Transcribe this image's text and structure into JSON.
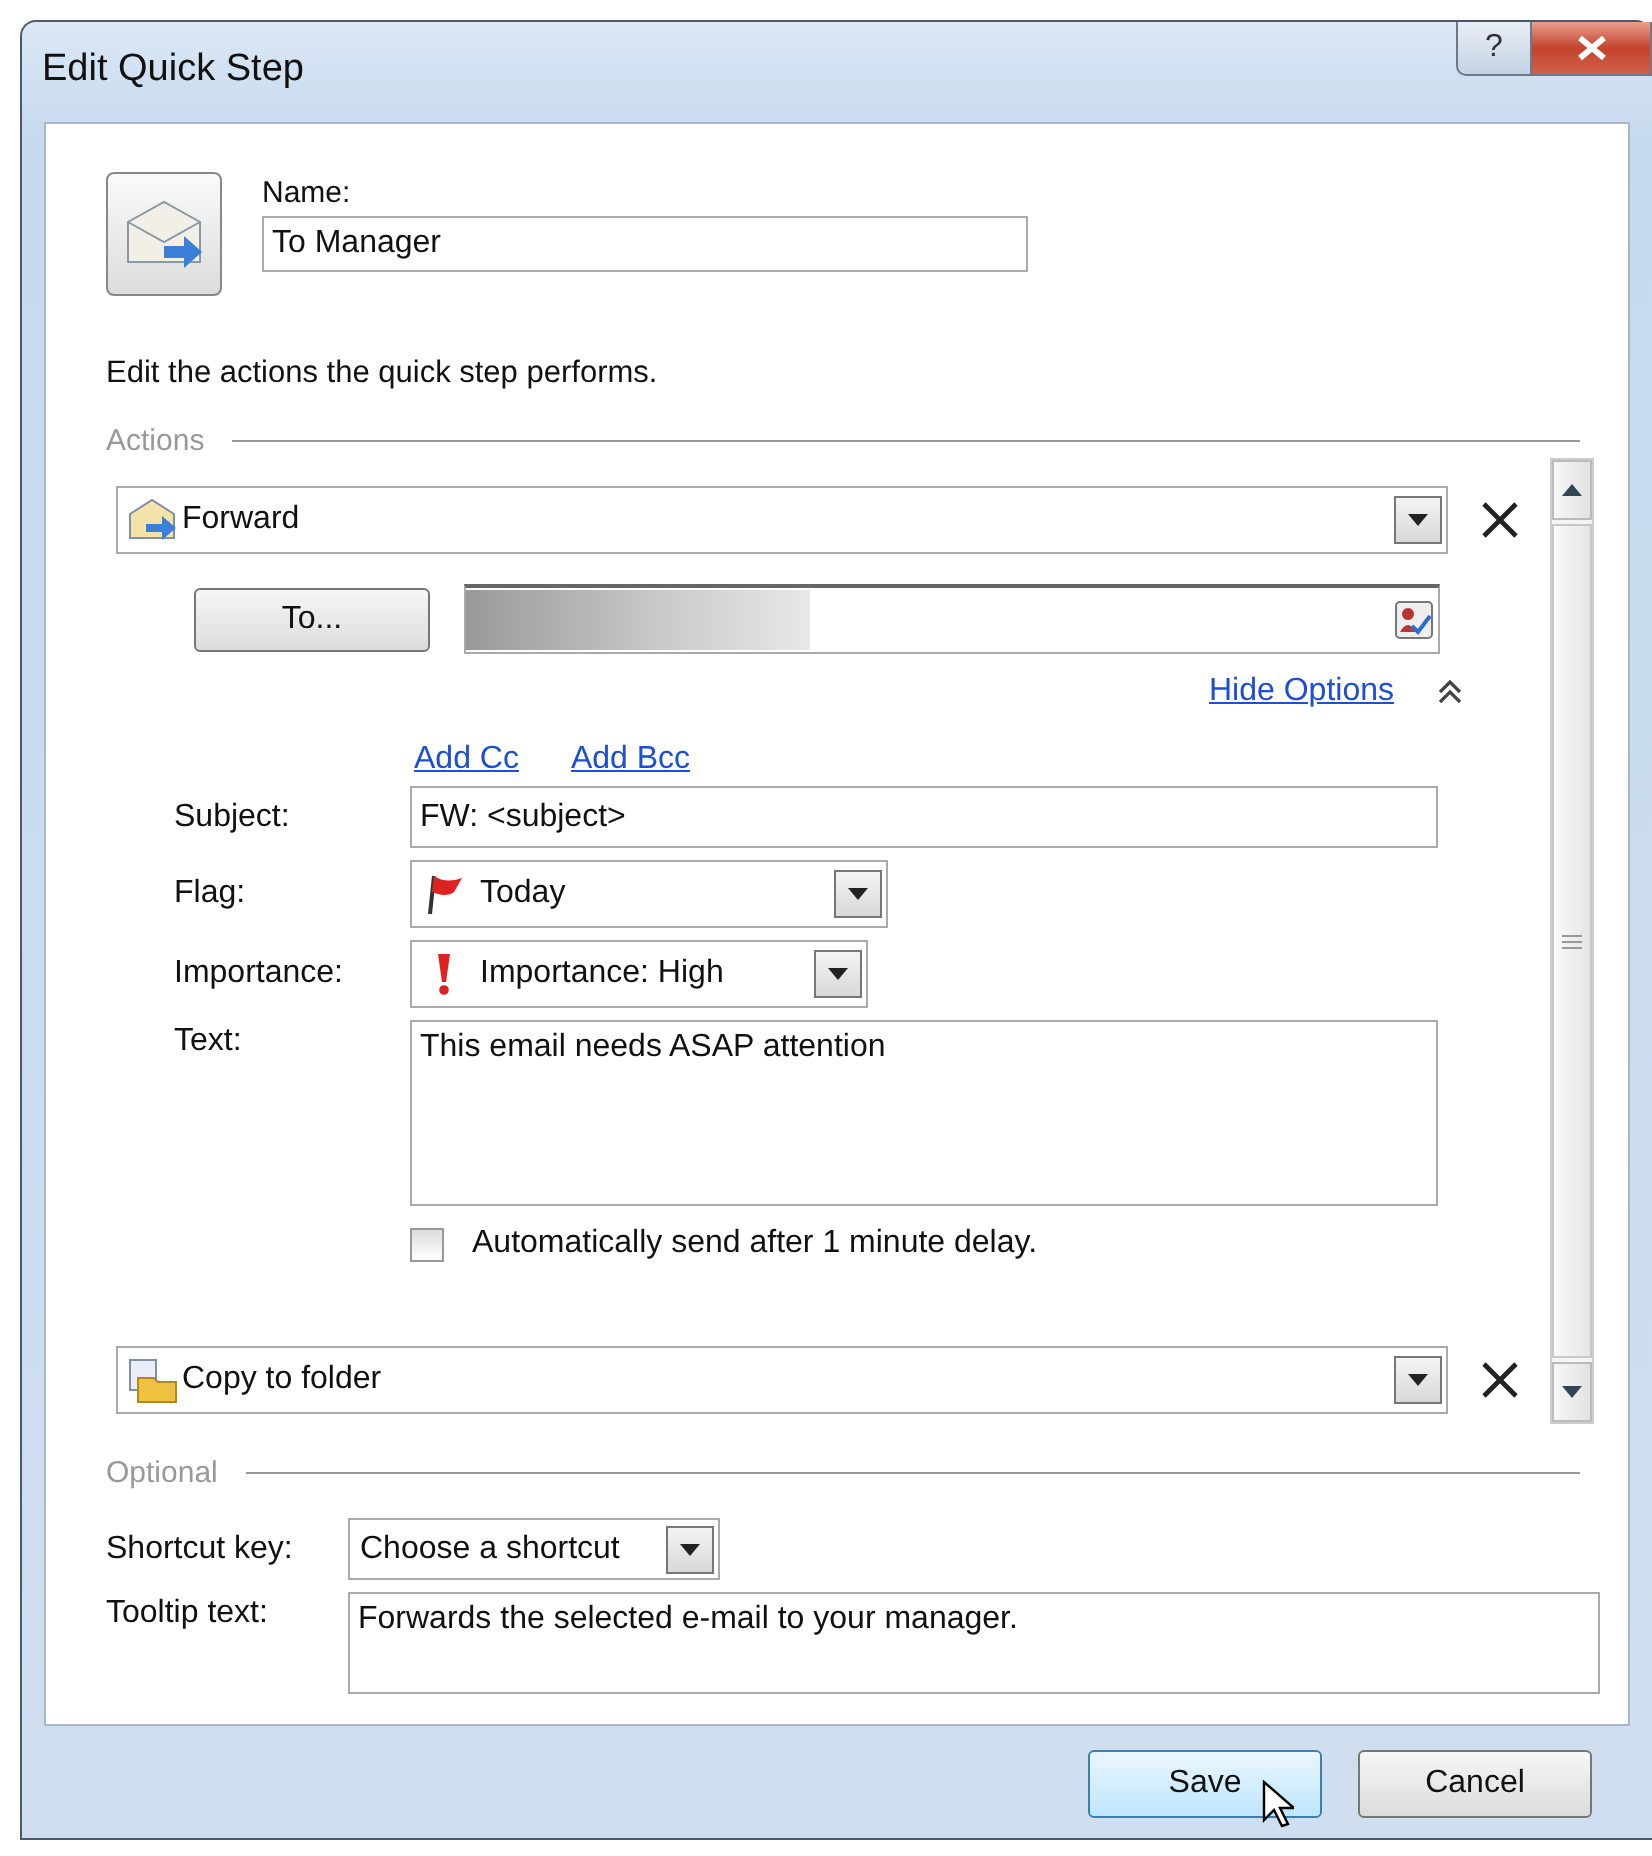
{
  "window": {
    "title": "Edit Quick Step",
    "title_buttons": [
      {
        "kind": "help",
        "label": "?"
      },
      {
        "kind": "close"
      }
    ]
  },
  "name": {
    "label": "Name:",
    "value": "To Manager"
  },
  "instruction": "Edit the actions the quick step performs.",
  "actions": {
    "legend": "Actions",
    "items": [
      {
        "kind": "forward",
        "label": "Forward",
        "expanded": true,
        "to_button": "To...",
        "hide_options": "Hide Options",
        "links": [
          "Add Cc",
          "Add Bcc"
        ],
        "fields": [
          {
            "kind": "text",
            "label": "Subject:",
            "value": "FW: <subject>"
          },
          {
            "kind": "flag",
            "label": "Flag:",
            "value": "Today"
          },
          {
            "kind": "importance",
            "label": "Importance:",
            "value": "Importance: High"
          },
          {
            "kind": "textarea",
            "label": "Text:",
            "value": "This email needs ASAP attention"
          }
        ],
        "checkbox": {
          "label": "Automatically send after 1 minute delay.",
          "checked": false
        }
      },
      {
        "kind": "copy",
        "label": "Copy to folder",
        "expanded": false
      }
    ]
  },
  "optional": {
    "legend": "Optional",
    "shortcut": {
      "label": "Shortcut key:",
      "value": "Choose a shortcut"
    },
    "tooltip": {
      "label": "Tooltip text:",
      "value": "Forwards the selected e-mail to your manager."
    }
  },
  "buttons": [
    {
      "label": "Save",
      "hovered": true
    },
    {
      "label": "Cancel",
      "hovered": false
    }
  ]
}
